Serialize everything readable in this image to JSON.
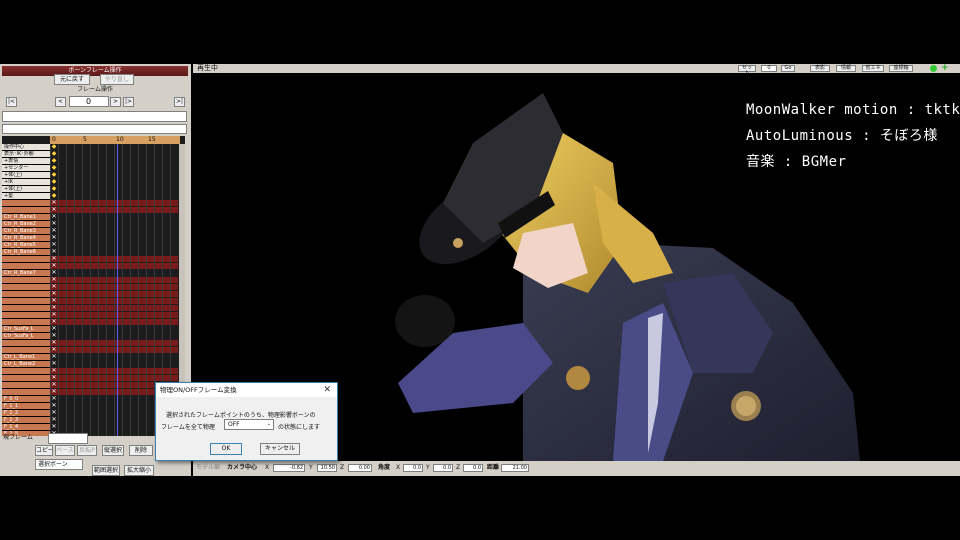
{
  "panel": {
    "bone_section": "ボーンフレーム操作",
    "restore": "元に戻す",
    "redo": "やり直し",
    "frame_section": "フレーム操作",
    "frame_value": "0",
    "nav_first": "|<",
    "nav_prev": "<",
    "nav_next": ">",
    "nav_nextkey": "|>",
    "nav_last": ">|",
    "ruler": [
      "0",
      "5",
      "10",
      "15"
    ],
    "bones": [
      "操作中心",
      "表示･IK･外観",
      "+表情",
      "+センター",
      "+体(上)",
      "+IK",
      "+体(上)",
      "+髪",
      "",
      "",
      "Ctr_R_Bane1",
      "Ctr_R_Bane2",
      "Ctr_R_Bane3",
      "Ctr_R_Bane4",
      "Ctr_R_Bane5",
      "Ctr_R_Bane6",
      "",
      "",
      "Ctr_R_Bane7",
      "",
      "",
      "",
      "",
      "",
      "",
      "",
      "Ctr_SusFa_L",
      "Ctr_SusFa_L",
      "",
      "",
      "Ctr_L_Bane1",
      "Ctr_L_Bane2",
      "",
      "",
      "",
      "",
      "F_0_0",
      "F_1_1",
      "F_1_2",
      "F_1_3",
      "F_1_4",
      "F_1_5",
      "F_1_6",
      "F_1_7"
    ],
    "curr_frame": "現フレーム",
    "copy": "コピー",
    "paste": "ペースト",
    "reverse_paste": "反転P",
    "select": "縦選択",
    "delete": "削除",
    "select_bone": "選択ボーン",
    "range_select": "範囲選択",
    "expand": "拡大縮小"
  },
  "viewport": {
    "status": "再生中",
    "credit_1": "MoonWalker motion : tktk様",
    "credit_2": "AutoLuminous : そぼろ様",
    "credit_3": "音楽 : BGMer"
  },
  "toolbar": {
    "set": "セット",
    "set_value": "0",
    "go": "Go",
    "shadow": "表影",
    "info": "情報",
    "sleep": "省エネ",
    "coord": "座標軸"
  },
  "bottombar": {
    "model_label": "モデル編",
    "camera_center": "カメラ中心",
    "x_label": "X",
    "y_label": "Y",
    "z_label": "Z",
    "cx": "-0.82",
    "cy": "10.50",
    "cz": "0.00",
    "angle": "角度",
    "ax": "0.0",
    "ay": "0.0",
    "az": "0.0",
    "dist_label": "距離",
    "dist": "21.00"
  },
  "dialog": {
    "title": "物理ON/OFFフレーム変換",
    "message_1": "選択されたフレームポイントのうち、物理影響ボーンの",
    "message_2_prefix": "フレームを全て物理",
    "select_value": "OFF",
    "message_2_suffix": "の状態にします",
    "ok": "OK",
    "cancel": "キャンセル"
  },
  "colors": {
    "accent_red": "#8a3030",
    "dialog_border": "#3c7fb1"
  }
}
